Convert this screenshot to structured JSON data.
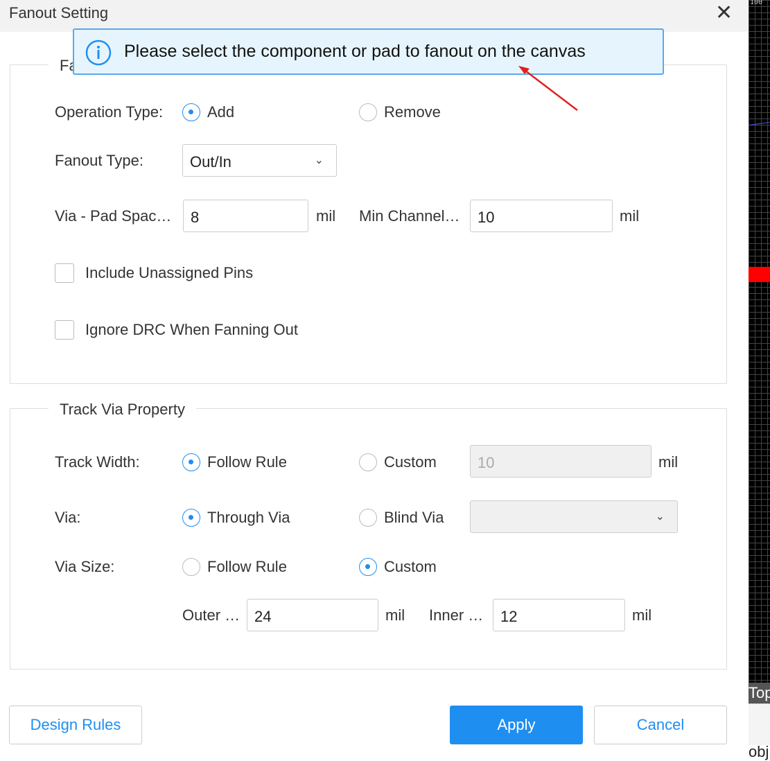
{
  "dialog": {
    "title": "Fanout Setting"
  },
  "tooltip": {
    "text": "Please select the component or pad to fanout on the canvas",
    "icon": "info-icon",
    "arrow_color": "#e02020"
  },
  "fanout": {
    "legend": "Fa",
    "operation_type": {
      "label": "Operation Type:",
      "options": [
        "Add",
        "Remove"
      ],
      "selected": "Add"
    },
    "fanout_type": {
      "label": "Fanout Type:",
      "value": "Out/In"
    },
    "via_pad_spacing": {
      "label": "Via - Pad Spac…",
      "value": "8",
      "unit": "mil"
    },
    "min_channel": {
      "label": "Min Channel…",
      "value": "10",
      "unit": "mil"
    },
    "include_unassigned": {
      "label": "Include Unassigned Pins",
      "checked": false
    },
    "ignore_drc": {
      "label": "Ignore DRC When Fanning Out",
      "checked": false
    }
  },
  "track_via": {
    "legend": "Track Via Property",
    "track_width": {
      "label": "Track Width:",
      "options": [
        "Follow Rule",
        "Custom"
      ],
      "selected": "Follow Rule",
      "value": "10",
      "unit": "mil"
    },
    "via": {
      "label": "Via:",
      "options": [
        "Through Via",
        "Blind Via"
      ],
      "selected": "Through Via",
      "select_value": ""
    },
    "via_size": {
      "label": "Via Size:",
      "options": [
        "Follow Rule",
        "Custom"
      ],
      "selected": "Custom"
    },
    "outer": {
      "label": "Outer …",
      "value": "24",
      "unit": "mil"
    },
    "inner": {
      "label": "Inner …",
      "value": "12",
      "unit": "mil"
    }
  },
  "buttons": {
    "design_rules": "Design Rules",
    "apply": "Apply",
    "cancel": "Cancel"
  },
  "canvas": {
    "ruler": "100",
    "layer": "Top",
    "bottom_text": "obj"
  },
  "colors": {
    "accent": "#1f8ef1",
    "tooltip_bg": "#e6f5fd",
    "canvas_bg": "#000000",
    "highlight": "#ff0000"
  }
}
